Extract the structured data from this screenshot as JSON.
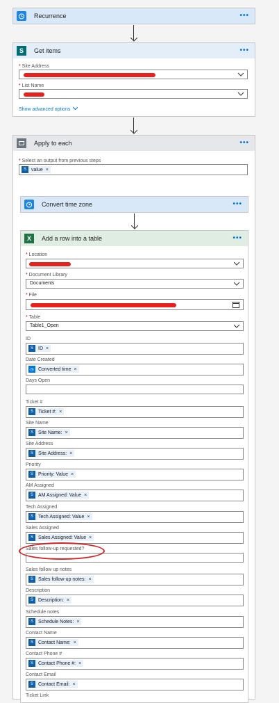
{
  "recurrence": {
    "title": "Recurrence",
    "menu": "•••"
  },
  "get_items": {
    "title": "Get items",
    "menu": "•••",
    "site_address_label": "Site Address",
    "list_name_label": "List Name",
    "advanced_link": "Show advanced options"
  },
  "apply_each": {
    "title": "Apply to each",
    "menu": "•••",
    "select_label": "Select an output from previous steps",
    "token": "value"
  },
  "convert_tz": {
    "title": "Convert time zone",
    "menu": "•••"
  },
  "add_row": {
    "title": "Add a row into a table",
    "menu": "•••",
    "location_label": "Location",
    "doc_lib_label": "Document Library",
    "doc_lib_value": "Documents",
    "file_label": "File",
    "table_label": "Table",
    "table_value": "Table1_Open",
    "fields": [
      {
        "label": "ID",
        "token": "ID"
      },
      {
        "label": "Date Created",
        "token": "Converted time"
      },
      {
        "label": "Days Open",
        "token": ""
      },
      {
        "label": "Ticket #",
        "token": "Ticket #:"
      },
      {
        "label": "Site Name",
        "token": "Site Name:"
      },
      {
        "label": "Site Address",
        "token": "Site Address:"
      },
      {
        "label": "Priority",
        "token": "Priority: Value"
      },
      {
        "label": "AM Assigned",
        "token": "AM Assigned: Value"
      },
      {
        "label": "Tech Assigned",
        "token": "Tech Assigned: Value"
      },
      {
        "label": "Sales Assigned",
        "token": "Sales Assigned: Value"
      },
      {
        "label": "Sales follow-up requested?",
        "token": ""
      },
      {
        "label": "Sales follow up notes",
        "token": "Sales follow-up notes:"
      },
      {
        "label": "Description",
        "token": "Description:"
      },
      {
        "label": "Schedule notes",
        "token": "Schedule Notes:"
      },
      {
        "label": "Contact Name",
        "token": "Contact Name:"
      },
      {
        "label": "Contact Phone #",
        "token": "Contact Phone #:"
      },
      {
        "label": "Contact Email",
        "token": "Contact Email:"
      },
      {
        "label": "Ticket Link",
        "token": ""
      }
    ]
  },
  "colors": {
    "accent": "#0078d4",
    "annotation": "#d62224",
    "redaction": "#e8201e",
    "excel": "#217346"
  }
}
